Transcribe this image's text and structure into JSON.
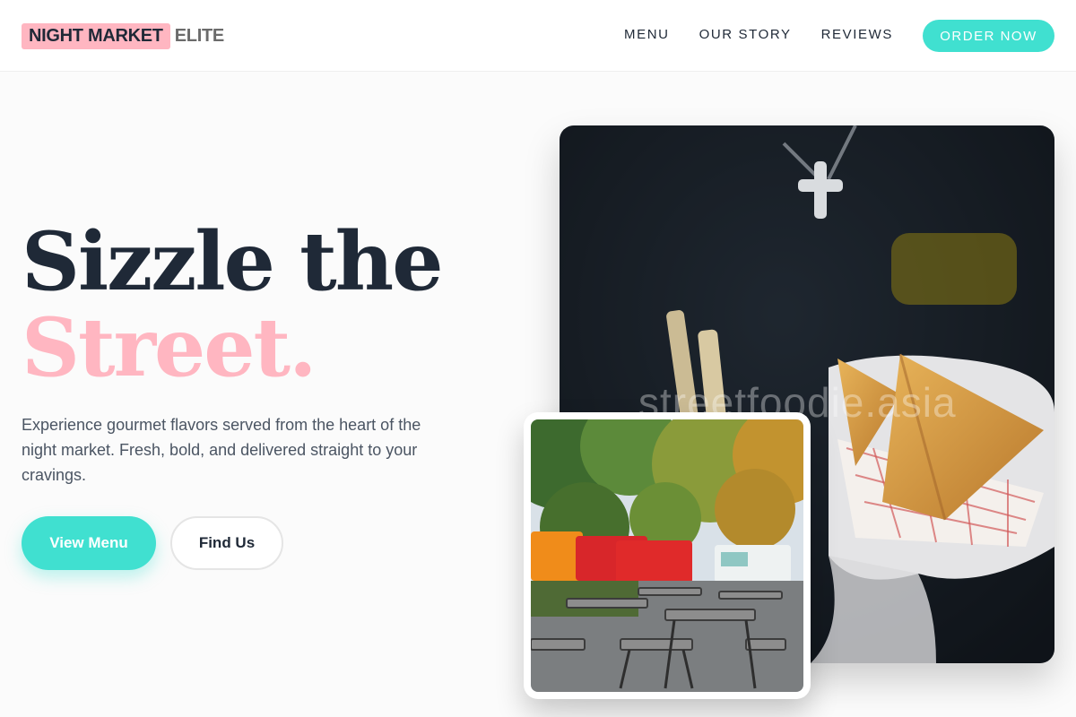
{
  "brand": {
    "name": "NIGHT MARKET",
    "suffix": "ELITE"
  },
  "nav": {
    "items": [
      {
        "label": "MENU"
      },
      {
        "label": "OUR STORY"
      },
      {
        "label": "REVIEWS"
      }
    ],
    "cta_label": "ORDER NOW"
  },
  "hero": {
    "title_line1": "Sizzle the",
    "title_line2": "Street.",
    "lead": "Experience gourmet flavors served from the heart of the night market. Fresh, bold, and delivered straight to your cravings.",
    "primary_label": "View Menu",
    "secondary_label": "Find Us"
  },
  "images": {
    "main_watermark": "streetfoodie.asia"
  },
  "colors": {
    "accent": "#40e0d0",
    "brand_pink": "#ffb6c1",
    "heading": "#1f2937"
  }
}
